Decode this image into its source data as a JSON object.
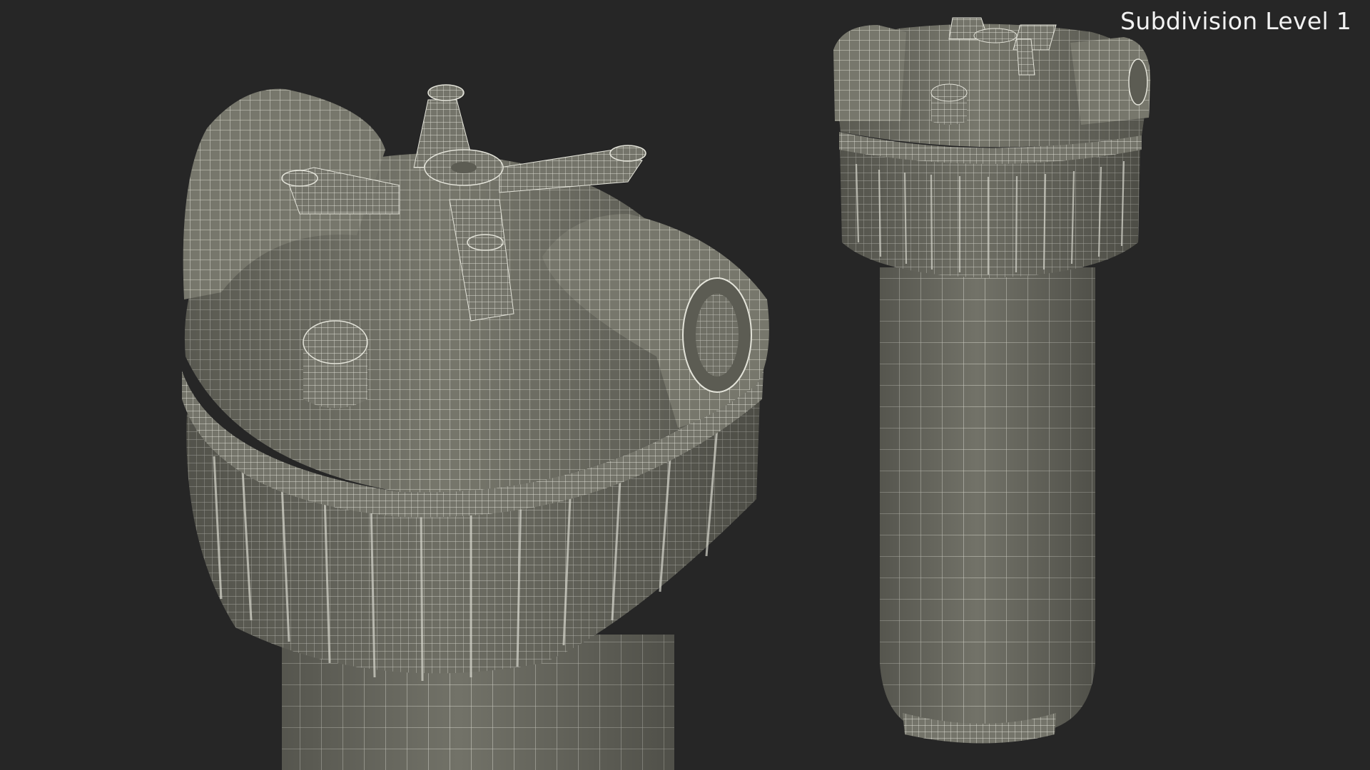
{
  "viewport": {
    "caption": "Subdivision Level 1",
    "background_color": "#262626",
    "mesh_fill_color": "#77776c",
    "mesh_wire_color": "#e4e4da"
  },
  "objects": [
    {
      "id": "filter-closeup",
      "name": "Water filter housing (close-up view)"
    },
    {
      "id": "filter-full",
      "name": "Water filter housing (full view)"
    }
  ]
}
